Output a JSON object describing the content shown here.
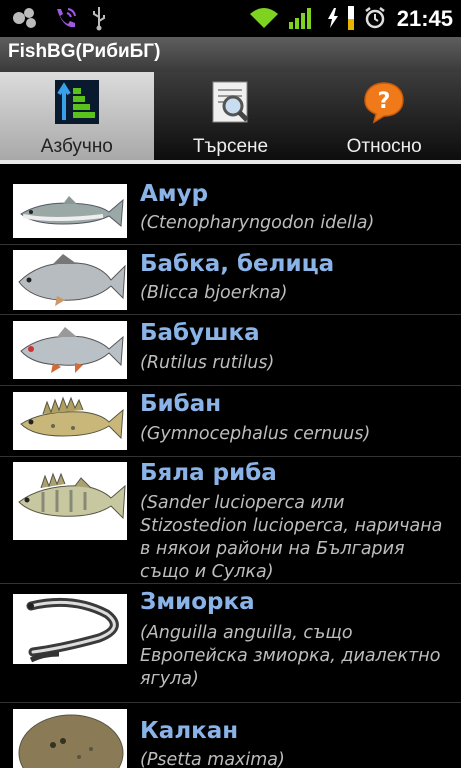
{
  "status_bar": {
    "time": "21:45",
    "icons": [
      "android-icon",
      "phone-call-icon",
      "usb-icon",
      "wifi-icon",
      "signal-icon",
      "charging-icon",
      "battery-icon",
      "alarm-icon"
    ]
  },
  "app": {
    "title": "FishBG(РибиБГ)"
  },
  "tabs": [
    {
      "label": "Азбучно",
      "icon": "alphabetic-sort-icon",
      "active": true
    },
    {
      "label": "Търсене",
      "icon": "search-document-icon",
      "active": false
    },
    {
      "label": "Относно",
      "icon": "question-icon",
      "active": false
    }
  ],
  "fish": [
    {
      "name": "Амур",
      "latin": "(Ctenopharyngodon idella)",
      "image": "grass-carp-image"
    },
    {
      "name": "Бабка, белица",
      "latin": "(Blicca bjoerkna)",
      "image": "silver-bream-image"
    },
    {
      "name": "Бабушка",
      "latin": "(Rutilus rutilus)",
      "image": "roach-image"
    },
    {
      "name": "Бибан",
      "latin": "(Gymnocephalus cernuus)",
      "image": "ruffe-image"
    },
    {
      "name": "Бяла риба",
      "latin": "(Sander lucioperca или Stizostedion lucioperca, наричана в някои райони на България също и Сулка)",
      "image": "zander-image"
    },
    {
      "name": "Змиорка",
      "latin": "(Anguilla anguilla, също Европейска змиорка, диалектно ягула)",
      "image": "eel-image"
    },
    {
      "name": "Калкан",
      "latin": "(Psetta maxima)",
      "image": "turbot-image"
    }
  ]
}
